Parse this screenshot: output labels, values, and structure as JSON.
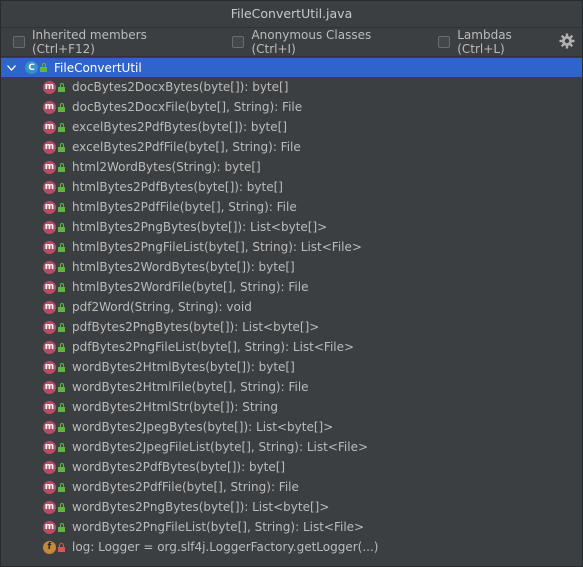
{
  "window": {
    "title": "FileConvertUtil.java"
  },
  "options": {
    "inherited": "Inherited members (Ctrl+F12)",
    "anonymous": "Anonymous Classes (Ctrl+I)",
    "lambdas": "Lambdas (Ctrl+L)"
  },
  "icons": {
    "gear": "gear-icon",
    "class": "class-icon",
    "method": "method-icon",
    "field": "field-icon",
    "public": "lock-open-icon",
    "private": "lock-closed-icon"
  },
  "colors": {
    "selection": "#2f65ca",
    "method_icon": "#b94c65",
    "public_lock": "#62b543",
    "private_lock": "#d9534f"
  },
  "tree": {
    "root": "FileConvertUtil",
    "root_icon_letter": "C",
    "method_icon_letter": "m",
    "field_icon_letter": "f",
    "members": [
      "docBytes2DocxBytes(byte[]): byte[]",
      "docBytes2DocxFile(byte[], String): File",
      "excelBytes2PdfBytes(byte[]): byte[]",
      "excelBytes2PdfFile(byte[], String): File",
      "html2WordBytes(String): byte[]",
      "htmlBytes2PdfBytes(byte[]): byte[]",
      "htmlBytes2PdfFile(byte[], String): File",
      "htmlBytes2PngBytes(byte[]): List<byte[]>",
      "htmlBytes2PngFileList(byte[], String): List<File>",
      "htmlBytes2WordBytes(byte[]): byte[]",
      "htmlBytes2WordFile(byte[], String): File",
      "pdf2Word(String, String): void",
      "pdfBytes2PngBytes(byte[]): List<byte[]>",
      "pdfBytes2PngFileList(byte[], String): List<File>",
      "wordBytes2HtmlBytes(byte[]): byte[]",
      "wordBytes2HtmlFile(byte[], String): File",
      "wordBytes2HtmlStr(byte[]): String",
      "wordBytes2JpegBytes(byte[]): List<byte[]>",
      "wordBytes2JpegFileList(byte[], String): List<File>",
      "wordBytes2PdfBytes(byte[]): byte[]",
      "wordBytes2PdfFile(byte[], String): File",
      "wordBytes2PngBytes(byte[]): List<byte[]>",
      "wordBytes2PngFileList(byte[], String): List<File>"
    ],
    "field": "log: Logger = org.slf4j.LoggerFactory.getLogger(...)"
  }
}
